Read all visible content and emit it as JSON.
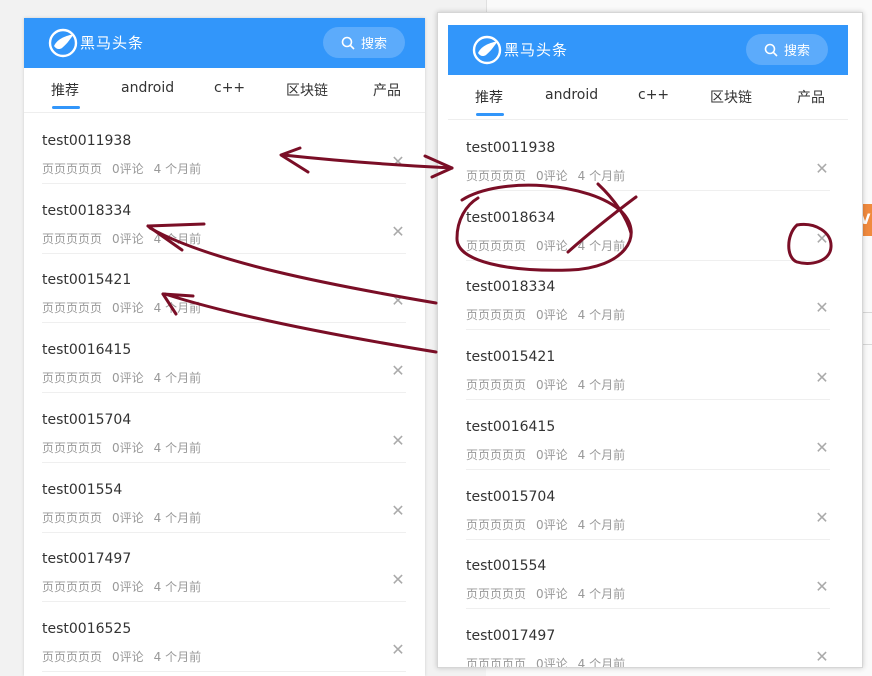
{
  "app": {
    "brand": "黑马头条",
    "search_label": "搜索",
    "colors": {
      "navbar": "#3296fa",
      "search_button": "#5cabfb",
      "annotation_ink": "#7a0e26",
      "edge_tag": "#f08a3e"
    }
  },
  "tabs": [
    "推荐",
    "android",
    "c++",
    "区块链",
    "产品"
  ],
  "active_tab": "推荐",
  "edge_tag_label": "V",
  "left_panel": {
    "articles": [
      {
        "title": "test0011938",
        "author": "页页页页页",
        "comments": "0评论",
        "time": "4 个月前"
      },
      {
        "title": "test0018334",
        "author": "页页页页页",
        "comments": "0评论",
        "time": "4 个月前"
      },
      {
        "title": "test0015421",
        "author": "页页页页页",
        "comments": "0评论",
        "time": "4 个月前"
      },
      {
        "title": "test0016415",
        "author": "页页页页页",
        "comments": "0评论",
        "time": "4 个月前"
      },
      {
        "title": "test0015704",
        "author": "页页页页页",
        "comments": "0评论",
        "time": "4 个月前"
      },
      {
        "title": "test001554",
        "author": "页页页页页",
        "comments": "0评论",
        "time": "4 个月前"
      },
      {
        "title": "test0017497",
        "author": "页页页页页",
        "comments": "0评论",
        "time": "4 个月前"
      },
      {
        "title": "test0016525",
        "author": "页页页页页",
        "comments": "0评论",
        "time": "4 个月前"
      }
    ]
  },
  "right_panel": {
    "articles": [
      {
        "title": "test0011938",
        "author": "页页页页页",
        "comments": "0评论",
        "time": "4 个月前"
      },
      {
        "title": "test0018634",
        "author": "页页页页页",
        "comments": "0评论",
        "time": "4 个月前"
      },
      {
        "title": "test0018334",
        "author": "页页页页页",
        "comments": "0评论",
        "time": "4 个月前"
      },
      {
        "title": "test0015421",
        "author": "页页页页页",
        "comments": "0评论",
        "time": "4 个月前"
      },
      {
        "title": "test0016415",
        "author": "页页页页页",
        "comments": "0评论",
        "time": "4 个月前"
      },
      {
        "title": "test0015704",
        "author": "页页页页页",
        "comments": "0评论",
        "time": "4 个月前"
      },
      {
        "title": "test001554",
        "author": "页页页页页",
        "comments": "0评论",
        "time": "4 个月前"
      },
      {
        "title": "test0017497",
        "author": "页页页页页",
        "comments": "0评论",
        "time": "4 个月前"
      }
    ]
  }
}
